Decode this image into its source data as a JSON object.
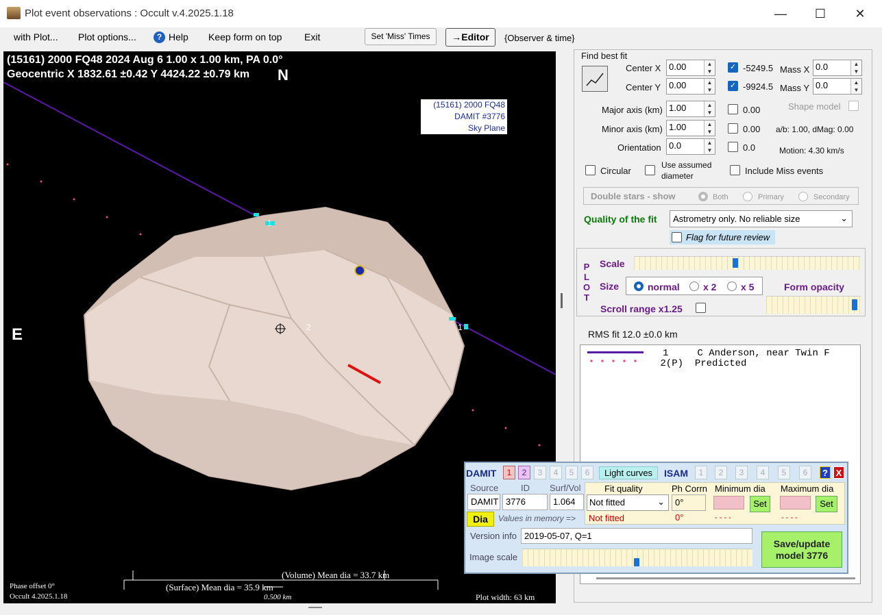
{
  "window": {
    "title": "Plot event observations : Occult v.4.2025.1.18",
    "min": "—",
    "max": "☐",
    "close": "✕"
  },
  "menu": {
    "with_plot": "with Plot...",
    "plot_options": "Plot options...",
    "help": "Help",
    "keep_on_top": "Keep form on top",
    "exit": "Exit",
    "set_miss": "Set 'Miss' Times",
    "editor": "→Editor",
    "observer_time": "{Observer & time}"
  },
  "plot": {
    "line1": "(15161) 2000 FQ48  2024 Aug 6  1.00 x 1.00 km, PA 0.0°",
    "line2": "Geocentric  X  1832.61 ±0.42  Y 4424.22 ±0.79 km",
    "north": "N",
    "east": "E",
    "tag1": "(15161) 2000 FQ48",
    "tag2": "DAMIT #3776",
    "tag3": "Sky Plane",
    "volume_dia": "(Volume) Mean dia = 33.7 km",
    "surface_dia": "(Surface) Mean dia = 35.9 km",
    "scale_km": "0.500 km",
    "phase_offset": "Phase offset 0°",
    "occult_ver": "Occult 4.2025.1.18",
    "plot_width": "Plot width: 63 km",
    "chord1_label": "1",
    "chord2_label": "2"
  },
  "fit": {
    "find_best_fit": "Find best fit",
    "center_x_label": "Center X",
    "center_x": "0.00",
    "center_x_val": "-5249.5",
    "center_y_label": "Center Y",
    "center_y": "0.00",
    "center_y_val": "-9924.5",
    "mass_x_label": "Mass X",
    "mass_x": "0.0",
    "mass_y_label": "Mass Y",
    "mass_y": "0.0",
    "major_label": "Major axis (km)",
    "major": "1.00",
    "major_val": "0.00",
    "minor_label": "Minor axis (km)",
    "minor": "1.00",
    "minor_val": "0.00",
    "orient_label": "Orientation",
    "orient": "0.0",
    "orient_val": "0.0",
    "shape_model": "Shape model",
    "ab_dmag": "a/b: 1.00, dMag: 0.00",
    "motion": "Motion: 4.30 km/s",
    "circular": "Circular",
    "use_assumed": "Use assumed",
    "diameter": "diameter",
    "include_miss": "Include Miss events",
    "double_stars": "Double stars - show",
    "both": "Both",
    "primary": "Primary",
    "secondary": "Secondary",
    "quality_label": "Quality of the fit",
    "quality_value": "Astrometry only. No reliable size",
    "flag_review": "Flag for future review"
  },
  "plotpanel": {
    "p": "P",
    "l": "L",
    "o": "O",
    "t": "T",
    "scale": "Scale",
    "size": "Size",
    "normal": "normal",
    "x2": "x 2",
    "x5": "x 5",
    "form_opacity": "Form opacity",
    "scroll_range": "Scroll range x1.25",
    "scale_level": 0.45,
    "opacity_level": 0.98
  },
  "rms": "RMS fit 12.0 ±0.0 km",
  "legend": [
    {
      "num": "1",
      "name": "C Anderson, near Twin F"
    },
    {
      "num": "2(P)",
      "name": "Predicted"
    }
  ],
  "damit": {
    "title": "DAMIT",
    "isam": "ISAM",
    "light_curves": "Light curves",
    "nums": [
      "1",
      "2",
      "3",
      "4",
      "5",
      "6"
    ],
    "isam_nums": [
      "1",
      "2",
      "3",
      "4",
      "5",
      "6"
    ],
    "help": "?",
    "close": "X",
    "source_h": "Source",
    "id_h": "ID",
    "surf_h": "Surf/Vol",
    "fit_h": "Fit quality",
    "ph_h": "Ph Corrn",
    "min_h": "Minimum dia",
    "max_h": "Maximum dia",
    "source": "DAMIT",
    "id": "3776",
    "surf": "1.064",
    "fit": "Not fitted",
    "ph": "0°",
    "dia_btn": "Dia",
    "values_mem": "Values in memory =>",
    "fit2": "Not fitted",
    "ph2": "0°",
    "min2": "- - - -",
    "max2": "- - - -",
    "set": "Set",
    "version_label": "Version info",
    "version": "2019-05-07, Q=1",
    "image_scale": "Image scale",
    "image_scale_level": 0.5,
    "save1": "Save/update",
    "save2": "model 3776"
  },
  "colors": {
    "accent": "#1565c0",
    "quality": "#0a7a0a",
    "purple": "#6a1a8a"
  }
}
